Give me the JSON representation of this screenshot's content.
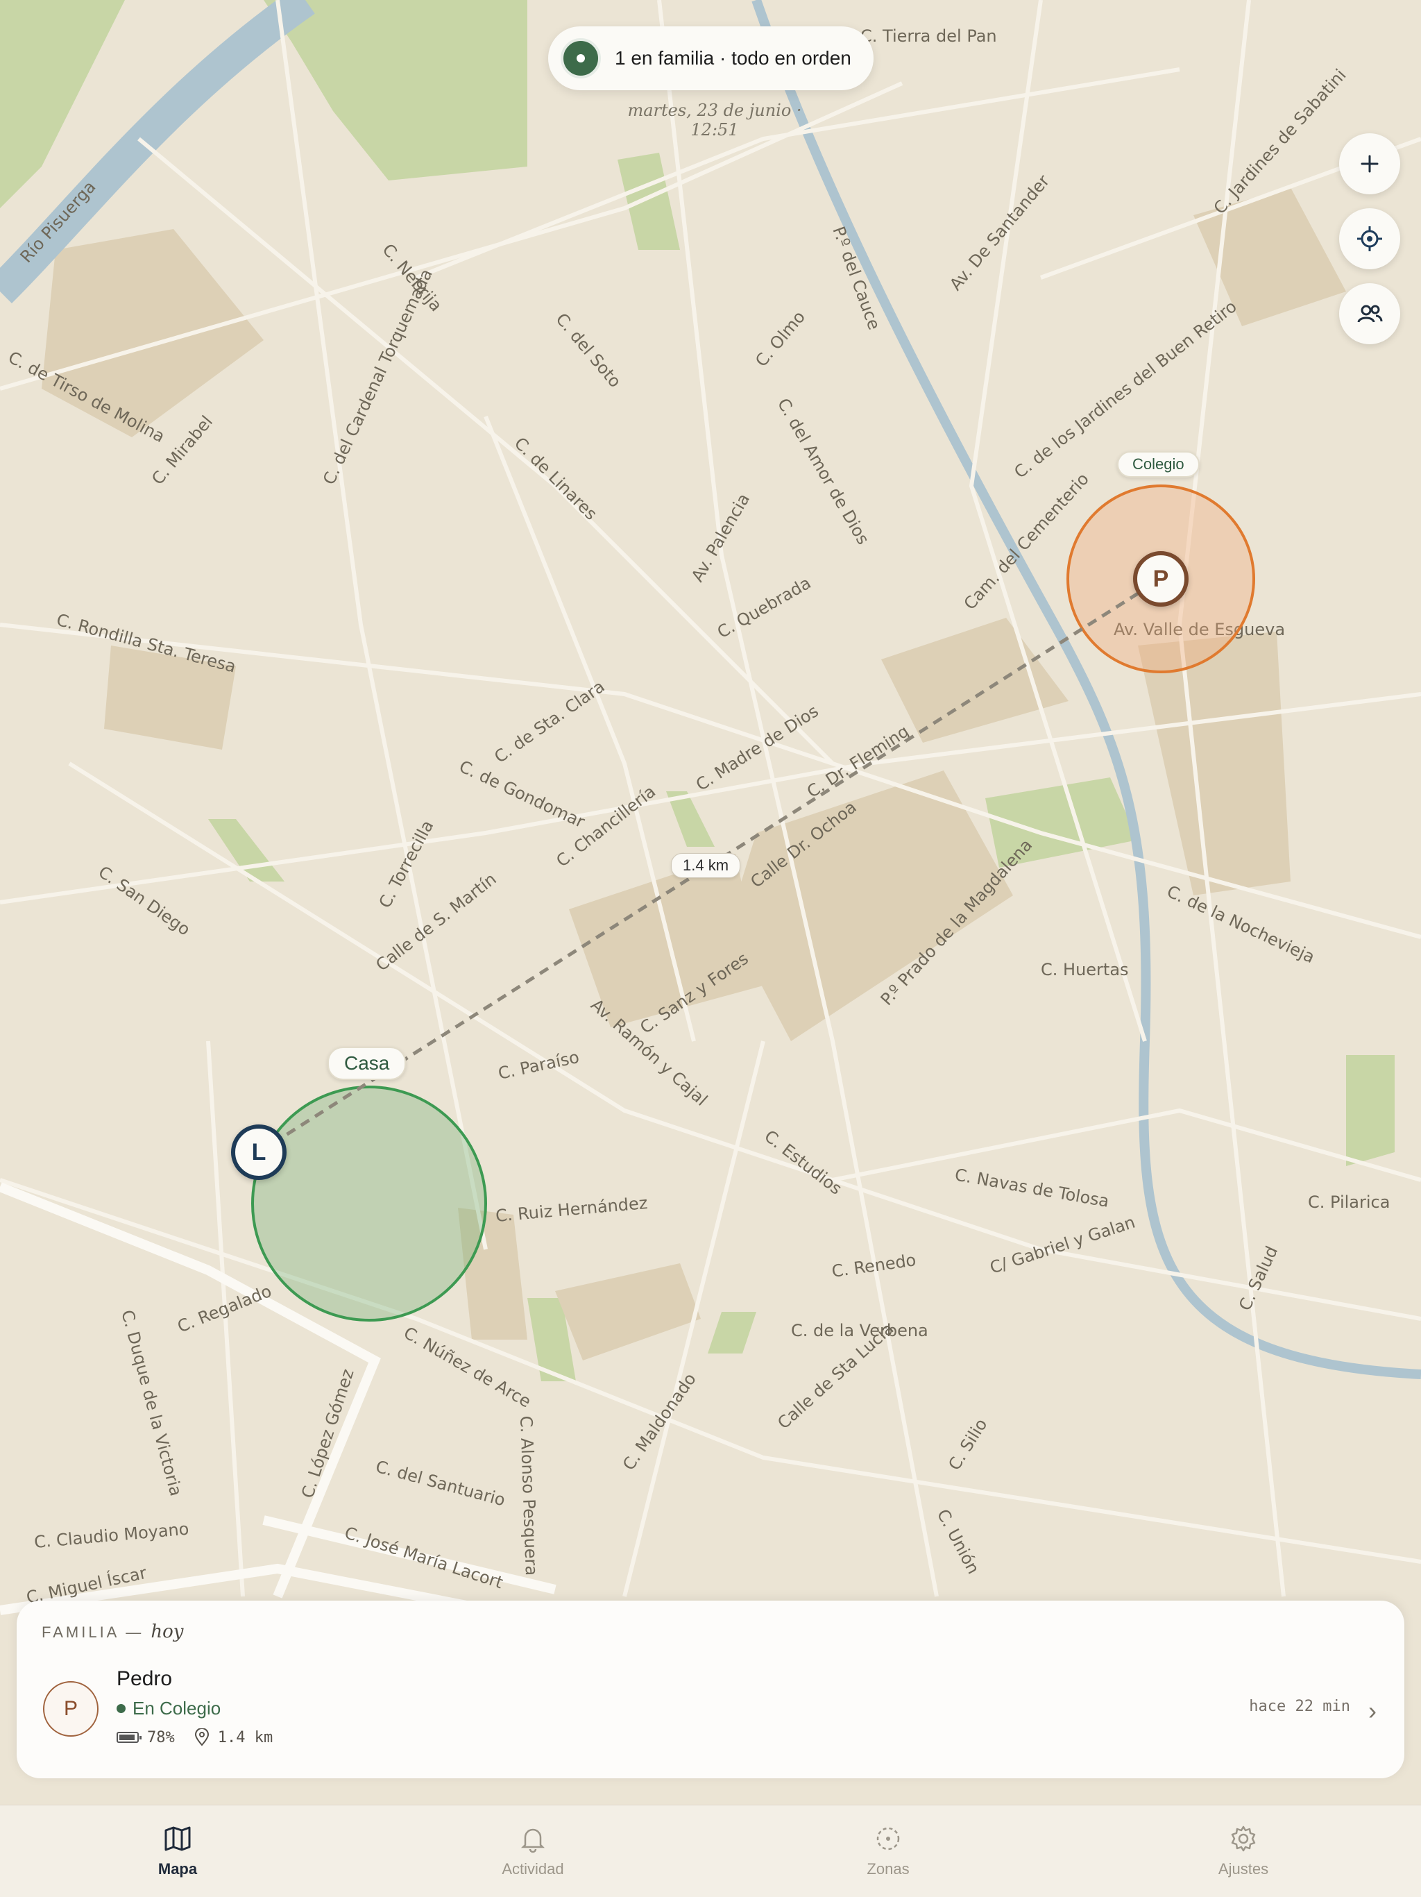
{
  "status": {
    "text": "1 en familia · todo en orden",
    "timestamp": "martes, 23 de junio · 12:51"
  },
  "map": {
    "places": {
      "home": "Casa",
      "school": "Colegio"
    },
    "distance_label": "1.4 km",
    "markers": {
      "home_member": "L",
      "school_member": "P"
    },
    "street_labels": [
      "C. Tierra del Pan",
      "Río Pisuerga",
      "C. Nebrija",
      "C. del Soto",
      "C. Olmo",
      "P.º del Cauce",
      "Av. De Santander",
      "C. Jardines de Sabatini",
      "C. de los Jardines del Buen Retiro",
      "Cam. del Cementerio",
      "C. de Tirso de Molina",
      "C. Mirabel",
      "C. del Cardenal Torquemada",
      "C. de Linares",
      "C. del Amor de Dios",
      "Av. Palencia",
      "C. Rondilla Sta. Teresa",
      "C. Quebrada",
      "Av. Valle de Esgueva",
      "C. de Sta. Clara",
      "C. de Gondomar",
      "C. Madre de Dios",
      "C. Dr. Fleming",
      "C. Chancillería",
      "Calle Dr. Ochoa",
      "C. San Diego",
      "Calle de S. Martín",
      "C. Torrecilla",
      "Av. Ramón y Cajal",
      "C. Sanz y Fores",
      "P.º Prado de la Magdalena",
      "C. Huertas",
      "C. de la Nochevieja",
      "C. Paraíso",
      "C. Ruiz Hernández",
      "C. Estudios",
      "C. Navas de Tolosa",
      "C. Pilarica",
      "C. Renedo",
      "C/ Gabriel y Galan",
      "C. de la Verbena",
      "C. Regalado",
      "C. Núñez de Arce",
      "C. López Gómez",
      "C. del Santuario",
      "C. José María Lacort",
      "C. Claudio Moyano",
      "C. Miguel Íscar",
      "C. Duque de la Victoria",
      "C. Alonso Pesquera",
      "C. Maldonado",
      "Calle de Sta Lucía",
      "C. Silio",
      "C. Unión",
      "C. Salud"
    ]
  },
  "controls": {
    "zoom_in": "+",
    "locate": "locate",
    "members": "members"
  },
  "sheet": {
    "heading": "FAMILIA —",
    "heading_italic": "hoy",
    "member": {
      "initial": "P",
      "name": "Pedro",
      "status": "En Colegio",
      "battery": "78%",
      "distance": "1.4 km",
      "last_seen": "hace 22 min"
    }
  },
  "tabs": [
    {
      "label": "Mapa",
      "icon": "map-icon",
      "active": true
    },
    {
      "label": "Actividad",
      "icon": "bell-icon",
      "active": false
    },
    {
      "label": "Zonas",
      "icon": "zone-icon",
      "active": false
    },
    {
      "label": "Ajustes",
      "icon": "gear-icon",
      "active": false
    }
  ],
  "colors": {
    "home": "#3d9a52",
    "school": "#e07a2f",
    "accent": "#3d6b4a",
    "water": "#aec4cf",
    "park": "#c6d4a4"
  }
}
